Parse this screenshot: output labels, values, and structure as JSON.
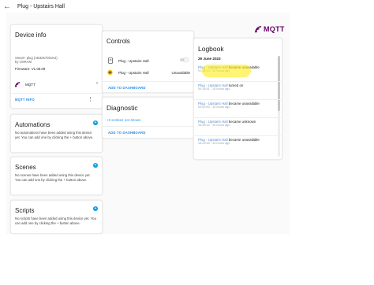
{
  "header": {
    "title": "Plug - Upstairs Hall"
  },
  "brand": {
    "name": "MQTT",
    "color": "#660066"
  },
  "device_info": {
    "title": "Device info",
    "model": "Smart+ plug (AB3257001NJ)",
    "manufacturer": "by OSRAM",
    "firmware": "Firmware: V1.05.09",
    "integration": "MQTT",
    "action": "MQTT INFO"
  },
  "automations": {
    "title": "Automations",
    "description": "No automations have been added using this device yet. You can add one by clicking the + button above."
  },
  "scenes": {
    "title": "Scenes",
    "description": "No scenes have been added using this device yet. You can add one by clicking the + button above."
  },
  "scripts": {
    "title": "Scripts",
    "description": "No scripts have been added using this device yet. You can add one by clicking the + button above."
  },
  "controls": {
    "title": "Controls",
    "rows": [
      {
        "label": "Plug - Upstairs Hall",
        "icon": "power-socket-icon"
      },
      {
        "label": "Plug - Upstairs Hall",
        "icon": "device-icon",
        "state": "Unavailable"
      }
    ],
    "action": "ADD TO DASHBOARD"
  },
  "diagnostic": {
    "title": "Diagnostic",
    "hidden": "+3 entities not shown",
    "action": "ADD TO DASHBOARD"
  },
  "logbook": {
    "title": "Logbook",
    "date": "29 June 2023",
    "entries": [
      {
        "entity": "Plug - Upstairs Hall",
        "message": " became unavailable",
        "time": "01:38:14 - 14 hours ago"
      },
      {
        "entity": "Plug - Upstairs Hall",
        "message": " turned on",
        "time": "00:18:51 - 15 hours ago"
      },
      {
        "entity": "Plug - Upstairs Hall",
        "message": " became unavailable",
        "time": "00:00:50 - 15 hours ago"
      },
      {
        "entity": "Plug - Upstairs Hall",
        "message": " became unknown",
        "time": "16:38:32 - 15 hours ago"
      },
      {
        "entity": "Plug - Upstairs Hall",
        "message": " became unavailable",
        "time": "16:29:53 - 15 hours ago"
      }
    ]
  },
  "colors": {
    "accent": "#1e88e5",
    "add_button": "#039be5",
    "highlight": "#ffeb00"
  }
}
